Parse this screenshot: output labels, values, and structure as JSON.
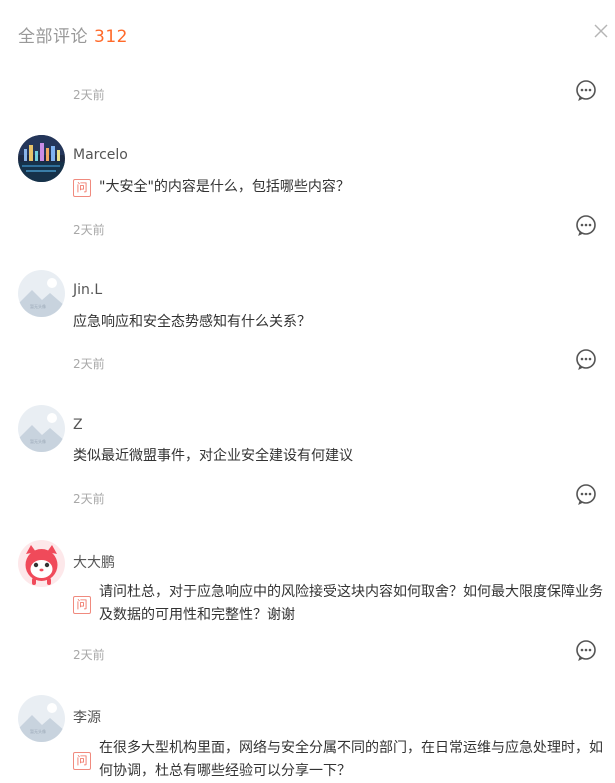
{
  "header": {
    "title": "全部评论",
    "count": "312"
  },
  "icons": {
    "close": "close-icon",
    "reply": "comment-bubble-icon",
    "question": "question-badge"
  },
  "colors": {
    "accent": "#ff6a2a",
    "badge": "#ef6c5c",
    "time": "#a8a8a8"
  },
  "first_time": "2天前",
  "comments": [
    {
      "username": "Marcelo",
      "badge": "问",
      "content": "\"大安全\"的内容是什么，包括哪些内容？",
      "time": "2天前"
    },
    {
      "username": "Jin.L",
      "badge": "",
      "content": "应急响应和安全态势感知有什么关系？",
      "time": "2天前"
    },
    {
      "username": "Z",
      "badge": "",
      "content": "类似最近微盟事件，对企业安全建设有何建议",
      "time": "2天前"
    },
    {
      "username": "大大鹏",
      "badge": "问",
      "content": "请问杜总，对于应急响应中的风险接受这块内容如何取舍？如何最大限度保障业务及数据的可用性和完整性？谢谢",
      "time": "2天前"
    },
    {
      "username": "李源",
      "badge": "问",
      "content": "在很多大型机构里面，网络与安全分属不同的部门，在日常运维与应急处理时，如何协调，杜总有哪些经验可以分享一下？",
      "time": ""
    }
  ]
}
